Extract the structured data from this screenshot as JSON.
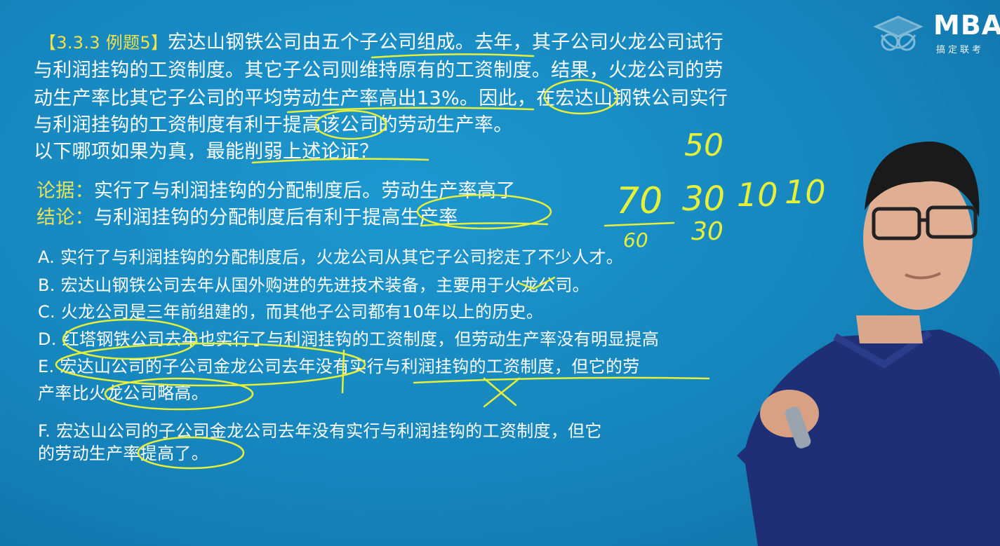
{
  "logo": {
    "brand": "MBA",
    "tagline": "搞定联考",
    "icon": "graduation-cap-owl-icon"
  },
  "question": {
    "tag": "【3.3.3 例题5】",
    "lines": [
      "宏达山钢铁公司由五个子公司组成。去年，其子公司火龙公司试行",
      "与利润挂钩的工资制度。其它子公司则维持原有的工资制度。结果，火龙公司的劳",
      "动生产率比其它子公司的平均劳动生产率高出13%。因此，在宏达山钢铁公司实行",
      "与利润挂钩的工资制度有利于提高该公司的劳动生产率。",
      "以下哪项如果为真，最能削弱上述论证？"
    ]
  },
  "analysis": {
    "premise_label": "论据：",
    "premise": "实行了与利润挂钩的分配制度后。劳动生产率高了",
    "conclusion_label": "结论：",
    "conclusion": "与利润挂钩的分配制度后有利于提高生产率"
  },
  "options": [
    "A. 实行了与利润挂钩的分配制度后，火龙公司从其它子公司挖走了不少人才。",
    "B. 宏达山钢铁公司去年从国外购进的先进技术装备，主要用于火龙公司。",
    "C. 火龙公司是三年前组建的，而其他子公司都有10年以上的历史。",
    "D. 红塔钢铁公司去年也实行了与利润挂钩的工资制度，但劳动生产率没有明显提高",
    "E. 宏达山公司的子公司金龙公司去年没有实行与利润挂钩的工资制度，但它的劳",
    "产率比火龙公司略高。",
    "F. 宏达山公司的子公司金龙公司去年没有实行与利润挂钩的工资制度，但它",
    "的劳动生产率提高了。"
  ],
  "handwriting": [
    "50",
    "70",
    "60",
    "30",
    "10",
    "10",
    "30"
  ],
  "colors": {
    "background": "#1685bd",
    "text": "#ffffff",
    "tag": "#f2e24a",
    "ink": "#e6f03a"
  }
}
